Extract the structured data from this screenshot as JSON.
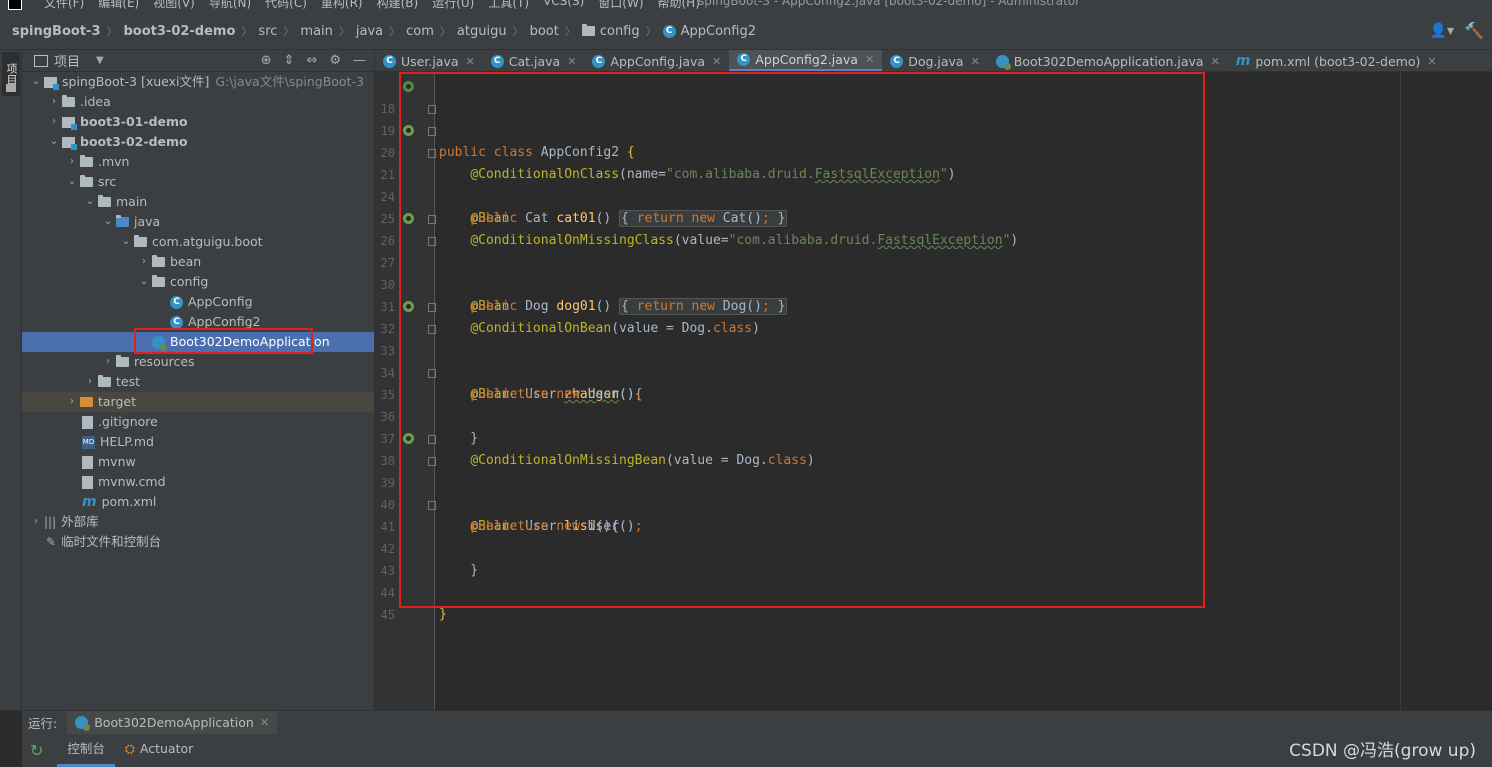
{
  "menubar": {
    "items": [
      "文件(F)",
      "编辑(E)",
      "视图(V)",
      "导航(N)",
      "代码(C)",
      "重构(R)",
      "构建(B)",
      "运行(U)",
      "工具(T)",
      "VCS(S)",
      "窗口(W)",
      "帮助(H)"
    ],
    "window_title": "spingBoot-3 - AppConfig2.java [boot3-02-demo] - Administrator"
  },
  "breadcrumb": [
    "spingBoot-3",
    "boot3-02-demo",
    "src",
    "main",
    "java",
    "com",
    "atguigu",
    "boot",
    "config",
    "AppConfig2"
  ],
  "project_panel": {
    "title": "项目",
    "tree": [
      {
        "label": "spingBoot-3 [xuexi文件]",
        "path": "G:\\java文件\\spingBoot-3"
      },
      {
        "label": ".idea"
      },
      {
        "label": "boot3-01-demo"
      },
      {
        "label": "boot3-02-demo"
      },
      {
        "label": ".mvn"
      },
      {
        "label": "src"
      },
      {
        "label": "main"
      },
      {
        "label": "java"
      },
      {
        "label": "com.atguigu.boot"
      },
      {
        "label": "bean"
      },
      {
        "label": "config"
      },
      {
        "label": "AppConfig"
      },
      {
        "label": "AppConfig2"
      },
      {
        "label": "Boot302DemoApplication"
      },
      {
        "label": "resources"
      },
      {
        "label": "test"
      },
      {
        "label": "target"
      },
      {
        "label": ".gitignore"
      },
      {
        "label": "HELP.md"
      },
      {
        "label": "mvnw"
      },
      {
        "label": "mvnw.cmd"
      },
      {
        "label": "pom.xml"
      },
      {
        "label": "外部库"
      },
      {
        "label": "临时文件和控制台"
      }
    ]
  },
  "editor_tabs": [
    "User.java",
    "Cat.java",
    "AppConfig.java",
    "AppConfig2.java",
    "Dog.java",
    "Boot302DemoApplication.java",
    "pom.xml (boot3-02-demo)"
  ],
  "code": {
    "line_numbers": [
      "18",
      "19",
      "20",
      "21",
      "24",
      "25",
      "26",
      "27",
      "30",
      "31",
      "32",
      "33",
      "34",
      "35",
      "36",
      "37",
      "38",
      "39",
      "40",
      "41",
      "42",
      "43",
      "44",
      "45"
    ],
    "class_name": "AppConfig2",
    "cond_class_value": "com.alibaba.druid.",
    "cond_class_name": "FastsqlException",
    "cat_method": "cat01",
    "dog_method": "dog01",
    "user1_method": "zhangsn",
    "user2_method": "lisi"
  },
  "run_panel": {
    "label": "运行:",
    "config": "Boot302DemoApplication",
    "tabs": [
      "控制台",
      "Actuator"
    ]
  },
  "watermark": "CSDN @冯浩(grow up)"
}
